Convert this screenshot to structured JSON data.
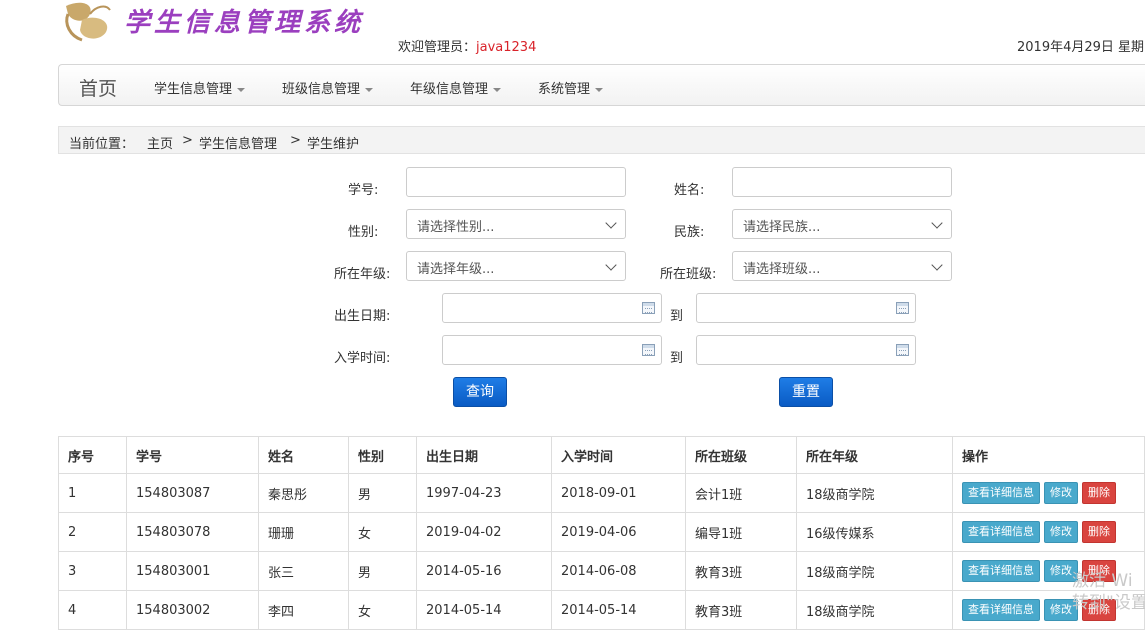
{
  "header": {
    "logo_text": "学生信息管理系统",
    "welcome_label": "欢迎管理员：",
    "username": "java1234",
    "date": "2019年4月29日 星期"
  },
  "navbar": {
    "brand": "首页",
    "items": [
      {
        "label": "学生信息管理"
      },
      {
        "label": "班级信息管理"
      },
      {
        "label": "年级信息管理"
      },
      {
        "label": "系统管理"
      }
    ]
  },
  "breadcrumb": {
    "prefix": "当前位置：",
    "items": [
      "主页",
      "学生信息管理",
      "学生维护"
    ],
    "separator": ">"
  },
  "search_form": {
    "student_id_label": "学号:",
    "student_id_value": "",
    "name_label": "姓名:",
    "name_value": "",
    "gender_label": "性别:",
    "gender_placeholder": "请选择性别...",
    "ethnicity_label": "民族:",
    "ethnicity_placeholder": "请选择民族...",
    "grade_label": "所在年级:",
    "grade_placeholder": "请选择年级...",
    "class_label": "所在班级:",
    "class_placeholder": "请选择班级...",
    "birth_label": "出生日期:",
    "enroll_label": "入学时间:",
    "to_label": "到",
    "query_button": "查询",
    "reset_button": "重置"
  },
  "table": {
    "headers": [
      "序号",
      "学号",
      "姓名",
      "性别",
      "出生日期",
      "入学时间",
      "所在班级",
      "所在年级",
      "操作"
    ],
    "rows": [
      [
        "1",
        "154803087",
        "秦思彤",
        "男",
        "1997-04-23",
        "2018-09-01",
        "会计1班",
        "18级商学院"
      ],
      [
        "2",
        "154803078",
        "珊珊",
        "女",
        "2019-04-02",
        "2019-04-06",
        "编导1班",
        "16级传媒系"
      ],
      [
        "3",
        "154803001",
        "张三",
        "男",
        "2014-05-16",
        "2014-06-08",
        "教育3班",
        "18级商学院"
      ],
      [
        "4",
        "154803002",
        "李四",
        "女",
        "2014-05-14",
        "2014-05-14",
        "教育3班",
        "18级商学院"
      ]
    ],
    "actions": {
      "detail": "查看详细信息",
      "edit": "修改",
      "delete": "删除"
    }
  },
  "watermark": {
    "line1": "激活 Wi",
    "line2": "转到\"设置\""
  },
  "colors": {
    "accent_primary": "#0a5bc4",
    "username": "#d9232a",
    "logo_text": "#9b3fbf",
    "info_button": "#49a9cc",
    "danger_button": "#d9443f"
  }
}
